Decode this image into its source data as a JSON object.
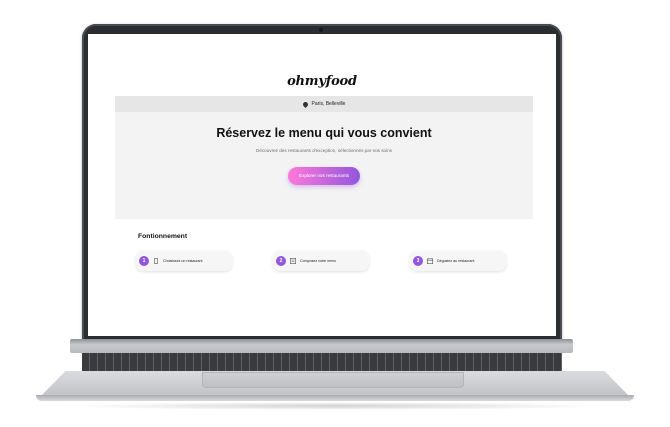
{
  "site": {
    "logo": "ohmyfood",
    "location": "Paris, Belleville"
  },
  "hero": {
    "title": "Réservez le menu qui vous convient",
    "subtitle": "Découvrez des restaurants d'exception, sélectionnés par nos soins",
    "cta_label": "Explorer nos restaurants"
  },
  "how": {
    "title": "Fontionnement",
    "steps": [
      {
        "number": "1",
        "icon": "phone-icon",
        "label": "Choisissez un restaurant"
      },
      {
        "number": "2",
        "icon": "list-icon",
        "label": "Composez votre menu"
      },
      {
        "number": "3",
        "icon": "calendar-icon",
        "label": "Dégustez au restaurant"
      }
    ]
  },
  "colors": {
    "accent_purple": "#9356dc",
    "accent_pink": "#ff79da",
    "hero_bg": "#f3f3f3",
    "location_bar_bg": "#e6e6e6",
    "laptop_bezel": "#2b2d31"
  }
}
